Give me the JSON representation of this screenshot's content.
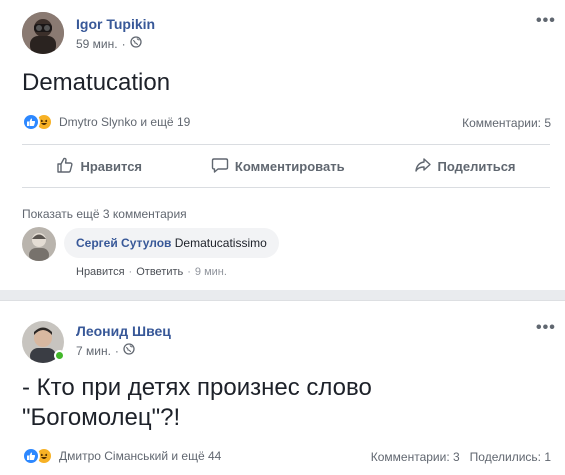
{
  "colors": {
    "accent": "#385898",
    "like": "#2d88ff",
    "haha": "#f7b125",
    "online": "#42b72a"
  },
  "post1": {
    "author": "Igor Tupikin",
    "time": "59 мин.",
    "privacy_icon": "globe-icon",
    "more_label": "•••",
    "text": "Dematucation",
    "reactions": {
      "icons": [
        "like-icon",
        "haha-icon"
      ],
      "summary": "Dmytro Slynko и ещё 19"
    },
    "comments_count": "Комментарии: 5",
    "actions": {
      "like": "Нравится",
      "comment": "Комментировать",
      "share": "Поделиться"
    },
    "show_more_comments": "Показать ещё 3 комментария",
    "comment": {
      "author": "Сергей Сутулов",
      "text": "Dematucatissimo",
      "like": "Нравится",
      "reply": "Ответить",
      "time": "9 мин.",
      "dot": "·"
    }
  },
  "post2": {
    "author": "Леонид Швец",
    "time": "7 мин.",
    "privacy_icon": "globe-icon",
    "more_label": "•••",
    "text_line1": "- Кто при детях произнес слово",
    "text_line2": "\"Богомолец\"?!",
    "reactions": {
      "icons": [
        "like-icon",
        "haha-icon"
      ],
      "summary": "Дмитро Сіманський и ещё 44"
    },
    "comments_count": "Комментарии: 3",
    "shares_count": "Поделились: 1"
  }
}
